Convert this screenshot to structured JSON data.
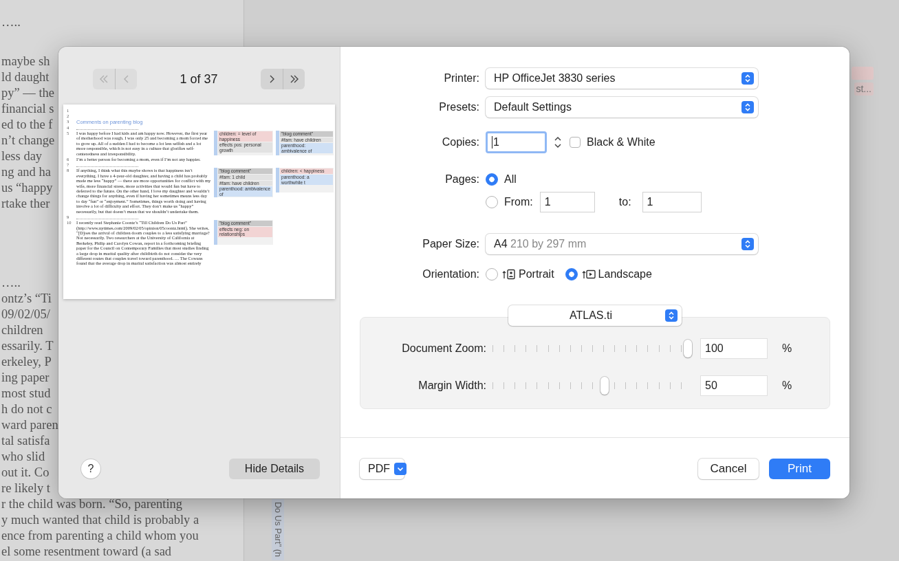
{
  "background_document": {
    "paragraphs": [
      [
        "….."
      ],
      [
        "maybe sh",
        "ld daught",
        "py” — the",
        "financial s",
        "ed to the f",
        "n’t change",
        "less day",
        "ng and ha",
        "us “happy",
        "rtake ther"
      ],
      [
        "…..",
        "ontz’s “Ti",
        "09/02/05/",
        "children",
        "essarily. T",
        "erkeley, P",
        "ing paper",
        "most stud",
        "h do not c",
        "ward paren",
        "tal satisfa",
        "who slid",
        "out it. Co",
        "re likely t",
        "r the child was born. “So, parenting",
        "y much wanted that child is probably a",
        "ence from parenting a child whom you",
        "el some resentment toward (a sad"
      ]
    ]
  },
  "background_margin": {
    "code_tag": "st...",
    "quote_label": "Do Us Part” (h"
  },
  "dialog": {
    "preview": {
      "nav_back": {
        "disabled": true
      },
      "page_indicator": "1 of 37",
      "nav_forward": {
        "disabled": false
      },
      "page_rows": [
        {
          "number": "1",
          "kind": "blank"
        },
        {
          "number": "2",
          "kind": "blank"
        },
        {
          "number": "3",
          "kind": "heading",
          "text": "Comments on parenting blog"
        },
        {
          "number": "4",
          "kind": "rule"
        },
        {
          "number": "5",
          "kind": "paragraph",
          "text": "I was happy before I had kids and am happy now. However, the first year of motherhood was rough. I was only 25 and becoming a mom forced me to grow up. All of a sudden I had to become a lot less selfish and a lot more responsible, which is not easy in a culture that glorifies self-centeredness and irresponsibility.",
          "codes_a": [
            {
              "label": "children: = level of happiness",
              "color": "#f2d4d4"
            },
            {
              "label": "effects pos: personal growth",
              "color": "#e2e2e2"
            }
          ],
          "codes_b": [
            {
              "label": "\"blog comment\"",
              "color": "#c9c9c9"
            },
            {
              "label": "#fam: have children",
              "color": "#e2e2e2"
            },
            {
              "label": "parenthood: ambivalence of",
              "color": "#cfe0f5"
            }
          ]
        },
        {
          "number": "6",
          "kind": "paragraph",
          "text": "I’m a better person for becoming a mom, even if I’m not any happier."
        },
        {
          "number": "7",
          "kind": "rule"
        },
        {
          "number": "8",
          "kind": "paragraph",
          "text": "If anything, I think what this maybe shows is that happiness isn’t everything. I have a 4-year-old daughter, and having a child has probably made me less “happy” — there are more opportunities for conflict with my wife, more financial stress, more activities that would fun but have to deferred to the future. On the other hand, I love my daughter and wouldn’t change things for anything, even if having her sometimes means less day to day “fun” or “enjoyment.” Sometimes, things worth doing and having involve a lot of difficulty and effort. They don’t make us “happy” necessarily, but that doesn’t mean that we shouldn’t undertake them.",
          "codes_a": [
            {
              "label": "\"blog comment\"",
              "color": "#c9c9c9"
            },
            {
              "label": "#fam: 1 child",
              "color": "#e2e2e2"
            },
            {
              "label": "#fam: have children",
              "color": "#e2e2e2"
            },
            {
              "label": "parenthood: ambivalence of",
              "color": "#cfe0f5"
            }
          ],
          "codes_b": [
            {
              "label": "children: < happiness",
              "color": "#f2d4d4"
            },
            {
              "label": "parenthood: a worthwhile t",
              "color": "#cfe0f5"
            }
          ]
        },
        {
          "number": "9",
          "kind": "rule"
        },
        {
          "number": "10",
          "kind": "paragraph",
          "text": "I recently read Stephanie Coontz’s “Till Children Do Us Part” (http://www.nytimes.com/2009/02/05/opinion/05coontz.html). She writes, “[D]oes the arrival of children doom couples to a less satisfying marriage? Not necessarily. Two researchers at the University of California at Berkeley, Philip and Carolyn Cowan, report in a forthcoming briefing paper for the Council on Contemporary Families that most studies finding a large drop in marital quality after childbirth do not consider the very different routes that couples travel toward parenthood. … The Cowans found that the average drop in marital satisfaction was almost entirely",
          "codes_a": [
            {
              "label": "\"blog comment\"",
              "color": "#c9c9c9"
            },
            {
              "label": "effects neg: on relationships",
              "color": "#f2d4d4"
            }
          ]
        }
      ]
    },
    "help_button": "?",
    "hide_details_button": "Hide Details",
    "printer": {
      "label": "Printer:",
      "value": "HP OfficeJet 3830 series"
    },
    "presets": {
      "label": "Presets:",
      "value": "Default Settings"
    },
    "copies": {
      "label": "Copies:",
      "value": "1",
      "black_white": {
        "label": "Black & White",
        "checked": false
      }
    },
    "pages": {
      "label": "Pages:",
      "options": [
        {
          "label": "All",
          "selected": true
        },
        {
          "label": "From:",
          "selected": false
        }
      ],
      "from_value": "1",
      "to_label": "to:",
      "to_value": "1"
    },
    "paper_size": {
      "label": "Paper Size:",
      "value": "A4",
      "detail": "210 by 297 mm"
    },
    "orientation": {
      "label": "Orientation:",
      "options": [
        {
          "label": "Portrait",
          "kind": "portrait",
          "selected": false
        },
        {
          "label": "Landscape",
          "kind": "landscape",
          "selected": true
        }
      ]
    },
    "section_popup": "ATLAS.ti",
    "settings": [
      {
        "label": "Document Zoom:",
        "level": 1,
        "value": "100",
        "unit": "%"
      },
      {
        "label": "Margin Width:",
        "level": 0.57,
        "value": "50",
        "unit": "%"
      }
    ],
    "pdf_button": "PDF",
    "cancel_button": "Cancel",
    "print_button": "Print"
  }
}
